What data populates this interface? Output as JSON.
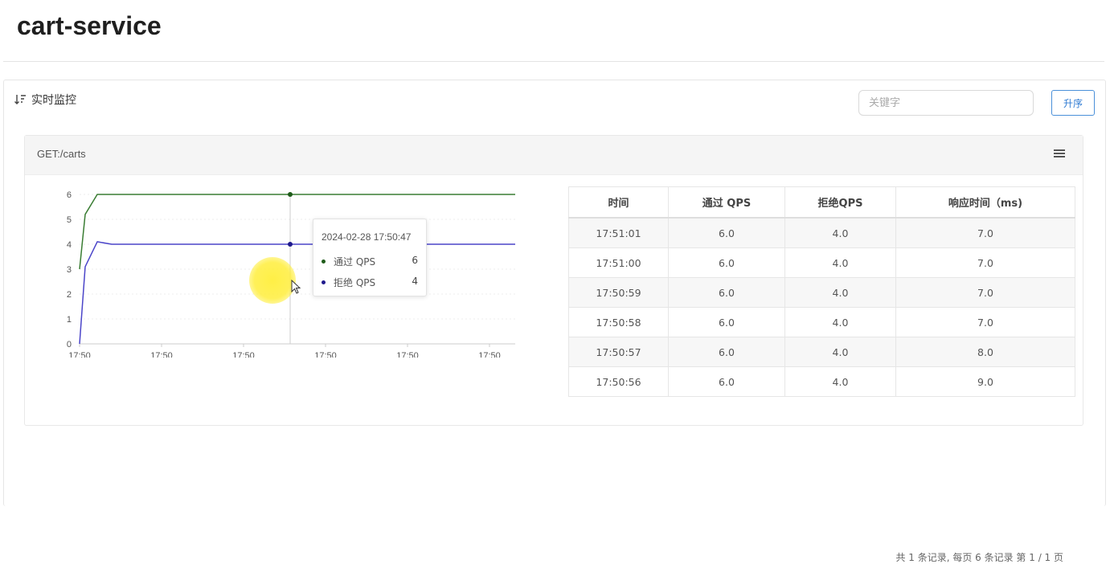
{
  "page": {
    "title": "cart-service"
  },
  "panel": {
    "heading": "实时监控",
    "search_placeholder": "关键字",
    "sort_button": "升序",
    "pagination": "共 1 条记录, 每页 6 条记录 第 1 / 1 页"
  },
  "card": {
    "resource": "GET:/carts"
  },
  "tooltip": {
    "time": "2024-02-28 17:50:47",
    "rows": [
      {
        "label": "通过 QPS",
        "value": "6"
      },
      {
        "label": "拒绝 QPS",
        "value": "4"
      }
    ]
  },
  "table": {
    "headers": [
      "时间",
      "通过 QPS",
      "拒绝QPS",
      "响应时间（ms)"
    ],
    "rows": [
      [
        "17:51:01",
        "6.0",
        "4.0",
        "7.0"
      ],
      [
        "17:51:00",
        "6.0",
        "4.0",
        "7.0"
      ],
      [
        "17:50:59",
        "6.0",
        "4.0",
        "7.0"
      ],
      [
        "17:50:58",
        "6.0",
        "4.0",
        "7.0"
      ],
      [
        "17:50:57",
        "6.0",
        "4.0",
        "8.0"
      ],
      [
        "17:50:56",
        "6.0",
        "4.0",
        "9.0"
      ]
    ]
  },
  "colors": {
    "pass": "#3a7d33",
    "block": "#4b45c9"
  },
  "icons": {
    "sort": "sort-desc-icon",
    "menu": "menu-icon"
  },
  "chart_data": {
    "type": "line",
    "yticks": [
      "0",
      "1",
      "2",
      "3",
      "4",
      "5",
      "6"
    ],
    "xticks": [
      "17:50",
      "17:50",
      "17:50",
      "17:50",
      "17:50",
      "17:50"
    ],
    "ylim": [
      0,
      6
    ],
    "legend": [
      "通过 QPS",
      "拒绝 QPS"
    ],
    "series": [
      {
        "name": "通过 QPS",
        "values": [
          3,
          5.2,
          6,
          6,
          6,
          6,
          6,
          6,
          6,
          6,
          6,
          6,
          6,
          6
        ]
      },
      {
        "name": "拒绝 QPS",
        "values": [
          0,
          3.1,
          4.1,
          4,
          4,
          4,
          4,
          4,
          4,
          4,
          4,
          4,
          4,
          4
        ]
      }
    ]
  }
}
